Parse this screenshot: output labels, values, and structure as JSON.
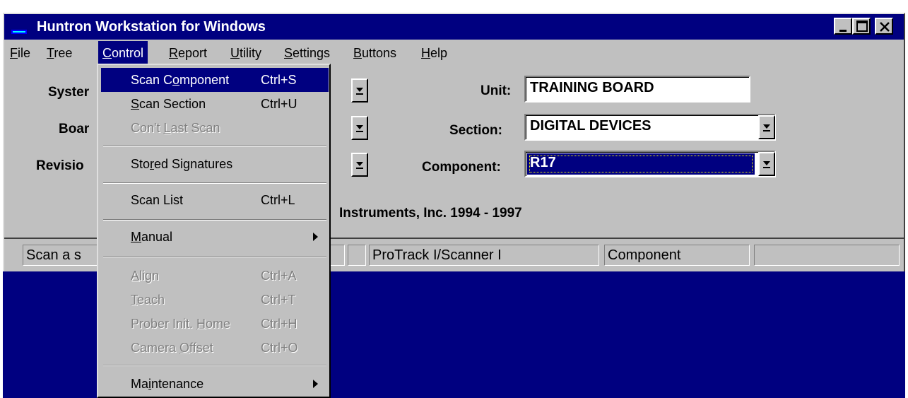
{
  "window": {
    "title": "Huntron Workstation for Windows"
  },
  "menubar": {
    "items": [
      {
        "prefix": "",
        "u": "F",
        "rest": "ile"
      },
      {
        "prefix": "",
        "u": "T",
        "rest": "ree"
      },
      {
        "prefix": "",
        "u": "C",
        "rest": "ontrol"
      },
      {
        "prefix": "",
        "u": "R",
        "rest": "eport"
      },
      {
        "prefix": "",
        "u": "U",
        "rest": "tility"
      },
      {
        "prefix": "",
        "u": "S",
        "rest": "ettings"
      },
      {
        "prefix": "",
        "u": "B",
        "rest": "uttons"
      },
      {
        "prefix": "",
        "u": "H",
        "rest": "elp"
      }
    ]
  },
  "form": {
    "system_label": "Syster",
    "board_label": "Boar",
    "revision_label": "Revisio",
    "unit_label": "Unit:",
    "unit_value": "TRAINING BOARD",
    "section_label": "Section:",
    "section_value": "DIGITAL DEVICES",
    "component_label": "Component:",
    "component_value": "R17",
    "copyright": "Instruments, Inc. 1994 - 1997"
  },
  "statusbar": {
    "cells": [
      "Scan a s",
      "",
      "ProTrack I/Scanner I",
      "Component",
      ""
    ]
  },
  "control_menu": {
    "items": [
      {
        "a": "Scan C",
        "u": "o",
        "b": "mponent",
        "accel": "Ctrl+S",
        "state": "highlighted"
      },
      {
        "a": "",
        "u": "S",
        "b": "can Section",
        "accel": "Ctrl+U",
        "state": "enabled"
      },
      {
        "a": "Con't ",
        "u": "L",
        "b": "ast Scan",
        "accel": "",
        "state": "disabled"
      },
      {
        "a": "Sto",
        "u": "r",
        "b": "ed Signatures",
        "accel": "",
        "state": "enabled"
      },
      {
        "a": "Scan List",
        "u": "",
        "b": "",
        "accel": "Ctrl+L",
        "state": "enabled"
      },
      {
        "a": "",
        "u": "M",
        "b": "anual",
        "accel": "",
        "state": "submenu"
      },
      {
        "a": "",
        "u": "A",
        "b": "lign",
        "accel": "Ctrl+A",
        "state": "disabled"
      },
      {
        "a": "",
        "u": "T",
        "b": "each",
        "accel": "Ctrl+T",
        "state": "disabled"
      },
      {
        "a": "Prober Init. ",
        "u": "H",
        "b": "ome",
        "accel": "Ctrl+H",
        "state": "disabled"
      },
      {
        "a": "Camera ",
        "u": "O",
        "b": "ffset",
        "accel": "Ctrl+O",
        "state": "disabled"
      },
      {
        "a": "Ma",
        "u": "i",
        "b": "ntenance",
        "accel": "",
        "state": "submenu"
      }
    ]
  },
  "colors": {
    "titlebar": "#000080",
    "desktop": "#000080",
    "face": "#c0c0c0"
  }
}
